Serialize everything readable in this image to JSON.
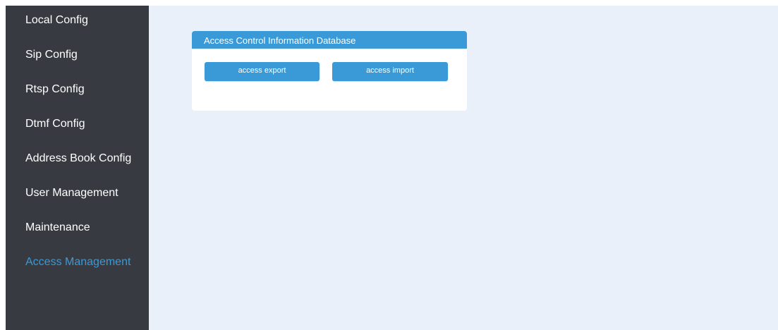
{
  "sidebar": {
    "items": [
      {
        "label": "Local Config",
        "active": false
      },
      {
        "label": "Sip Config",
        "active": false
      },
      {
        "label": "Rtsp Config",
        "active": false
      },
      {
        "label": "Dtmf Config",
        "active": false
      },
      {
        "label": "Address Book Config",
        "active": false
      },
      {
        "label": "User Management",
        "active": false
      },
      {
        "label": "Maintenance",
        "active": false
      },
      {
        "label": "Access Management",
        "active": true
      }
    ]
  },
  "panel": {
    "title": "Access Control Information Database",
    "export_label": "access export",
    "import_label": "access import"
  },
  "colors": {
    "sidebar_bg": "#373a40",
    "main_bg": "#eaf0f9",
    "accent": "#3a9ad8",
    "text_light": "#ffffff"
  }
}
